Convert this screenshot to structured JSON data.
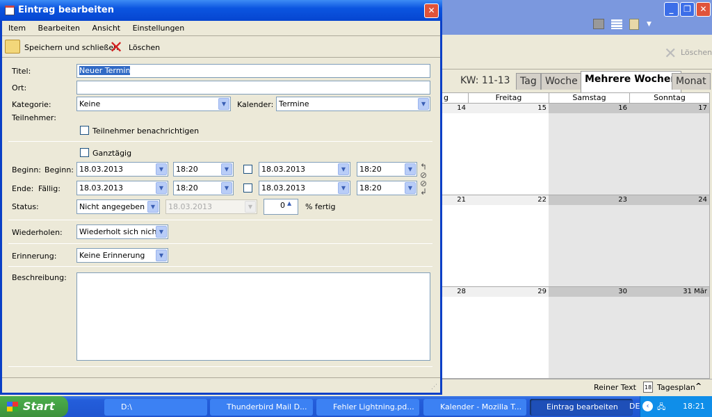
{
  "dialog": {
    "title": "Eintrag bearbeiten",
    "menu": [
      "Item",
      "Bearbeiten",
      "Ansicht",
      "Einstellungen"
    ],
    "toolbar": {
      "save": "Speichern und schließen",
      "delete": "Löschen"
    },
    "form": {
      "title_label": "Titel:",
      "title_value": "Neuer Termin",
      "location_label": "Ort:",
      "location_value": "",
      "category_label": "Kategorie:",
      "category_value": "Keine",
      "calendar_label": "Kalender:",
      "calendar_value": "Termine",
      "attendees_label": "Teilnehmer:",
      "notify_label": "Teilnehmer benachrichtigen",
      "allday_label": "Ganztägig",
      "start_label": "Beginn:",
      "start_label2": "Beginn:",
      "end_label": "Ende:",
      "due_label": "Fällig:",
      "start_date": "18.03.2013",
      "start_time": "18:20",
      "start_date2": "18.03.2013",
      "start_time2": "18:20",
      "end_date": "18.03.2013",
      "end_time": "18:20",
      "end_date2": "18.03.2013",
      "end_time2": "18:20",
      "status_label": "Status:",
      "status_value": "Nicht angegeben",
      "status_date": "18.03.2013",
      "percent_value": "0",
      "percent_label": "% fertig",
      "repeat_label": "Wiederholen:",
      "repeat_value": "Wiederholt sich nicht",
      "reminder_label": "Erinnerung:",
      "reminder_value": "Keine Erinnerung",
      "description_label": "Beschreibung:",
      "description_value": ""
    }
  },
  "main": {
    "delete": "Löschen",
    "week_range": "KW: 11-13",
    "tabs": [
      "Tag",
      "Woche",
      "Mehrere Wochen",
      "Monat"
    ],
    "active_tab": "Mehrere Wochen",
    "columns": [
      "g",
      "Freitag",
      "Samstag",
      "Sonntag"
    ],
    "weeks": [
      [
        "14",
        "15",
        "16",
        "17"
      ],
      [
        "21",
        "22",
        "23",
        "24"
      ],
      [
        "28",
        "29",
        "30",
        "31 Mär"
      ]
    ],
    "status": {
      "plain_text": "Reiner Text",
      "day_plan": "Tagesplan",
      "day_icon_num": "18"
    }
  },
  "taskbar": {
    "start": "Start",
    "items": [
      "D:\\",
      "Thunderbird Mail D...",
      "Fehler Lightning.pd...",
      "Kalender - Mozilla T...",
      "Eintrag bearbeiten"
    ],
    "lang": "DE",
    "clock": "18:21"
  }
}
